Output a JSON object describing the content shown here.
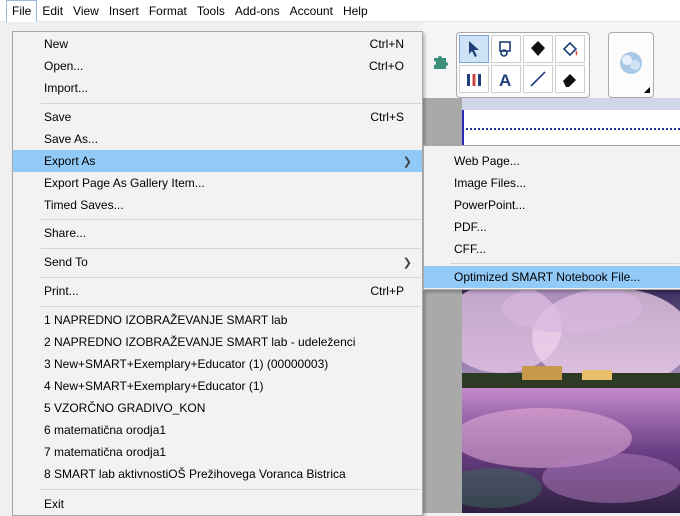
{
  "menubar": {
    "items": [
      "File",
      "Edit",
      "View",
      "Insert",
      "Format",
      "Tools",
      "Add-ons",
      "Account",
      "Help"
    ]
  },
  "file_menu": {
    "new": {
      "label": "New",
      "shortcut": "Ctrl+N"
    },
    "open": {
      "label": "Open...",
      "shortcut": "Ctrl+O"
    },
    "import": {
      "label": "Import..."
    },
    "save": {
      "label": "Save",
      "shortcut": "Ctrl+S"
    },
    "save_as": {
      "label": "Save As..."
    },
    "export_as": {
      "label": "Export As"
    },
    "export_gallery": {
      "label": "Export Page As Gallery Item..."
    },
    "timed_saves": {
      "label": "Timed Saves..."
    },
    "share": {
      "label": "Share..."
    },
    "send_to": {
      "label": "Send To"
    },
    "print": {
      "label": "Print...",
      "shortcut": "Ctrl+P"
    },
    "recent": [
      "1 NAPREDNO IZOBRAŽEVANJE SMART lab",
      "2 NAPREDNO IZOBRAŽEVANJE SMART lab - udeleženci",
      "3 New+SMART+Exemplary+Educator (1) (00000003)",
      "4 New+SMART+Exemplary+Educator (1)",
      "5 VZORČNO GRADIVO_KON",
      "6 matematična orodja1",
      "7 matematična orodja1",
      "8 SMART lab aktivnostiOŠ Prežihovega Voranca Bistrica"
    ],
    "exit": {
      "label": "Exit"
    }
  },
  "export_submenu": {
    "items": [
      "Web Page...",
      "Image Files...",
      "PowerPoint...",
      "PDF...",
      "CFF...",
      "Optimized SMART Notebook File..."
    ],
    "highlighted_index": 5
  },
  "colors": {
    "highlight": "#91c9f7",
    "menu_bg": "#f2f2f2",
    "canvas_border": "#2b2bb8"
  },
  "toolbar": {
    "icons": [
      "puzzle-icon",
      "select-arrow-icon",
      "shapes-icon",
      "fill-icon",
      "paint-bucket-icon",
      "pens-icon",
      "text-icon",
      "line-icon",
      "eraser-icon",
      "gallery-icon"
    ]
  }
}
